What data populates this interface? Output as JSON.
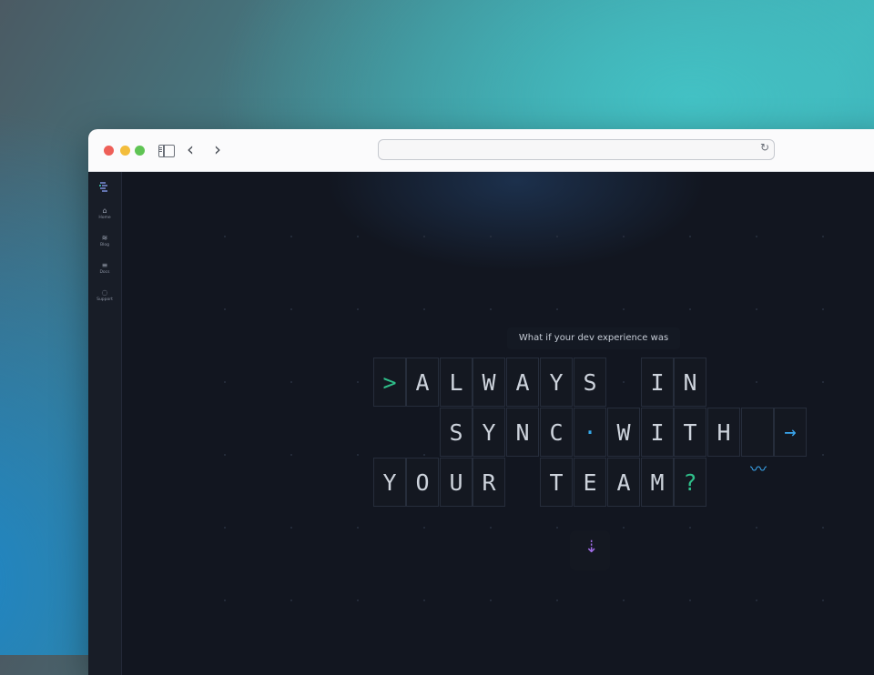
{
  "browser": {
    "url": ""
  },
  "sidebar": {
    "items": [
      {
        "label": "Home",
        "icon": "home-icon",
        "glyph": "⌂"
      },
      {
        "label": "Blog",
        "icon": "rss-icon",
        "glyph": "≋"
      },
      {
        "label": "Docs",
        "icon": "docs-icon",
        "glyph": "≡"
      },
      {
        "label": "Support",
        "icon": "support-icon",
        "glyph": "◌"
      }
    ]
  },
  "hero": {
    "tagline": "What if your dev experience was",
    "rows": [
      [
        ">",
        "A",
        "L",
        "W",
        "A",
        "Y",
        "S",
        "",
        "I",
        "N"
      ],
      [
        "S",
        "Y",
        "N",
        "C",
        "·",
        "W",
        "I",
        "T",
        "H"
      ],
      [
        "Y",
        "O",
        "U",
        "R",
        "",
        "T",
        "E",
        "A",
        "M",
        "?"
      ]
    ],
    "prompt_symbol": ">",
    "question_mark": "?",
    "arrow_symbol": "→",
    "down_symbol": "⇣"
  },
  "colors": {
    "accent_green": "#2fbf8a",
    "accent_blue": "#36a8e8",
    "accent_purple": "#a06ce6",
    "background": "#121620"
  }
}
